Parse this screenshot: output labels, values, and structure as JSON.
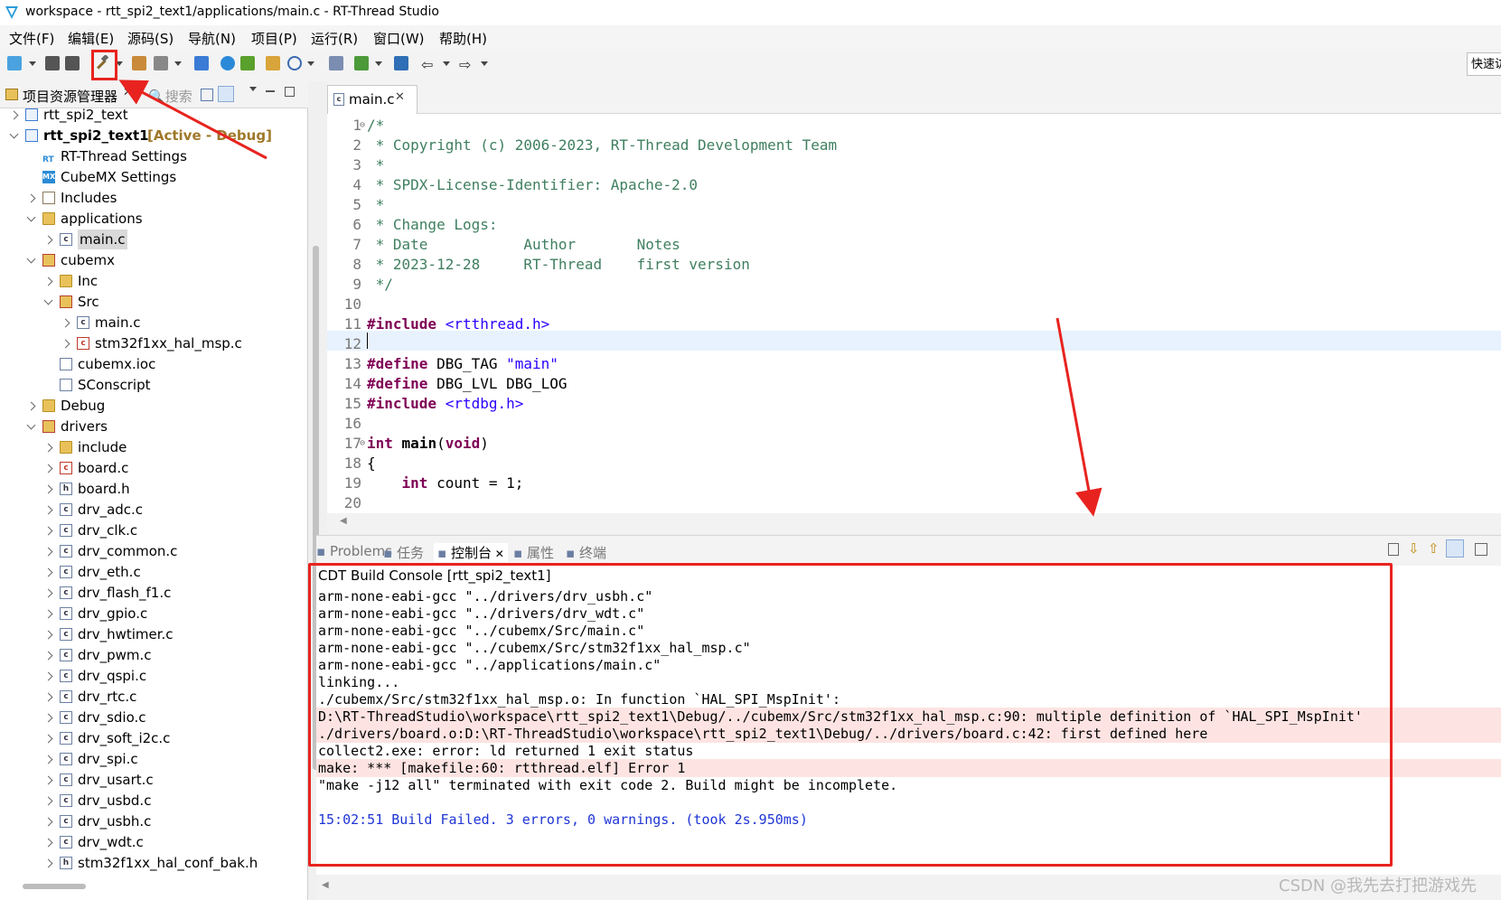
{
  "window": {
    "title": "workspace - rtt_spi2_text1/applications/main.c - RT-Thread Studio",
    "quick_access": "快速访"
  },
  "menu": [
    "文件(F)",
    "编辑(E)",
    "源码(S)",
    "导航(N)",
    "项目(P)",
    "运行(R)",
    "窗口(W)",
    "帮助(H)"
  ],
  "left_panel": {
    "tab_label": "项目资源管理器",
    "search_tab": "搜索",
    "tree": [
      {
        "label": "rtt_spi2_text",
        "tag": "",
        "icon": "project-icon",
        "state": "collapsed",
        "depth": 0
      },
      {
        "label": "rtt_spi2_text1",
        "tag": "[Active - Debug]",
        "icon": "project-icon",
        "state": "expanded",
        "depth": 0,
        "bold": true
      },
      {
        "label": "RT-Thread Settings",
        "tag": "",
        "icon": "rt-settings-icon",
        "state": "none",
        "depth": 1
      },
      {
        "label": "CubeMX Settings",
        "tag": "",
        "icon": "cubemx-icon",
        "state": "none",
        "depth": 1
      },
      {
        "label": "Includes",
        "tag": "",
        "icon": "includes-icon",
        "state": "collapsed",
        "depth": 1
      },
      {
        "label": "applications",
        "tag": "",
        "icon": "folder-icon",
        "state": "expanded",
        "depth": 1
      },
      {
        "label": "main.c",
        "tag": "",
        "icon": "c-file-icon",
        "state": "collapsed",
        "depth": 2,
        "selected": true
      },
      {
        "label": "cubemx",
        "tag": "",
        "icon": "source-folder-icon",
        "state": "expanded",
        "depth": 1
      },
      {
        "label": "Inc",
        "tag": "",
        "icon": "folder-icon",
        "state": "collapsed",
        "depth": 2
      },
      {
        "label": "Src",
        "tag": "",
        "icon": "source-folder-icon",
        "state": "expanded",
        "depth": 2
      },
      {
        "label": "main.c",
        "tag": "",
        "icon": "c-file-icon",
        "state": "collapsed",
        "depth": 3
      },
      {
        "label": "stm32f1xx_hal_msp.c",
        "tag": "",
        "icon": "c-file-error-icon",
        "state": "collapsed",
        "depth": 3
      },
      {
        "label": "cubemx.ioc",
        "tag": "",
        "icon": "file-icon",
        "state": "none",
        "depth": 2
      },
      {
        "label": "SConscript",
        "tag": "",
        "icon": "file-icon",
        "state": "none",
        "depth": 2
      },
      {
        "label": "Debug",
        "tag": "",
        "icon": "folder-icon",
        "state": "collapsed",
        "depth": 1
      },
      {
        "label": "drivers",
        "tag": "",
        "icon": "source-folder-icon",
        "state": "expanded",
        "depth": 1
      },
      {
        "label": "include",
        "tag": "",
        "icon": "folder-icon",
        "state": "collapsed",
        "depth": 2
      },
      {
        "label": "board.c",
        "tag": "",
        "icon": "c-file-error-icon",
        "state": "collapsed",
        "depth": 2
      },
      {
        "label": "board.h",
        "tag": "",
        "icon": "h-file-icon",
        "state": "collapsed",
        "depth": 2
      },
      {
        "label": "drv_adc.c",
        "tag": "",
        "icon": "c-file-icon",
        "state": "collapsed",
        "depth": 2
      },
      {
        "label": "drv_clk.c",
        "tag": "",
        "icon": "c-file-icon",
        "state": "collapsed",
        "depth": 2
      },
      {
        "label": "drv_common.c",
        "tag": "",
        "icon": "c-file-icon",
        "state": "collapsed",
        "depth": 2
      },
      {
        "label": "drv_eth.c",
        "tag": "",
        "icon": "c-file-icon",
        "state": "collapsed",
        "depth": 2
      },
      {
        "label": "drv_flash_f1.c",
        "tag": "",
        "icon": "c-file-icon",
        "state": "collapsed",
        "depth": 2
      },
      {
        "label": "drv_gpio.c",
        "tag": "",
        "icon": "c-file-icon",
        "state": "collapsed",
        "depth": 2
      },
      {
        "label": "drv_hwtimer.c",
        "tag": "",
        "icon": "c-file-icon",
        "state": "collapsed",
        "depth": 2
      },
      {
        "label": "drv_pwm.c",
        "tag": "",
        "icon": "c-file-icon",
        "state": "collapsed",
        "depth": 2
      },
      {
        "label": "drv_qspi.c",
        "tag": "",
        "icon": "c-file-icon",
        "state": "collapsed",
        "depth": 2
      },
      {
        "label": "drv_rtc.c",
        "tag": "",
        "icon": "c-file-icon",
        "state": "collapsed",
        "depth": 2
      },
      {
        "label": "drv_sdio.c",
        "tag": "",
        "icon": "c-file-icon",
        "state": "collapsed",
        "depth": 2
      },
      {
        "label": "drv_soft_i2c.c",
        "tag": "",
        "icon": "c-file-icon",
        "state": "collapsed",
        "depth": 2
      },
      {
        "label": "drv_spi.c",
        "tag": "",
        "icon": "c-file-icon",
        "state": "collapsed",
        "depth": 2
      },
      {
        "label": "drv_usart.c",
        "tag": "",
        "icon": "c-file-icon",
        "state": "collapsed",
        "depth": 2
      },
      {
        "label": "drv_usbd.c",
        "tag": "",
        "icon": "c-file-icon",
        "state": "collapsed",
        "depth": 2
      },
      {
        "label": "drv_usbh.c",
        "tag": "",
        "icon": "c-file-icon",
        "state": "collapsed",
        "depth": 2
      },
      {
        "label": "drv_wdt.c",
        "tag": "",
        "icon": "c-file-icon",
        "state": "collapsed",
        "depth": 2
      },
      {
        "label": "stm32f1xx_hal_conf_bak.h",
        "tag": "",
        "icon": "h-file-icon",
        "state": "collapsed",
        "depth": 2
      }
    ]
  },
  "editor": {
    "tab_label": "main.c",
    "lines": [
      {
        "n": "1",
        "fold": true,
        "parts": [
          [
            "cm",
            "/*"
          ]
        ]
      },
      {
        "n": "2",
        "parts": [
          [
            "cm",
            " * Copyright (c) 2006-2023, RT-Thread Development Team"
          ]
        ]
      },
      {
        "n": "3",
        "parts": [
          [
            "cm",
            " *"
          ]
        ]
      },
      {
        "n": "4",
        "parts": [
          [
            "cm",
            " * SPDX-License-Identifier: Apache-2.0"
          ]
        ]
      },
      {
        "n": "5",
        "parts": [
          [
            "cm",
            " *"
          ]
        ]
      },
      {
        "n": "6",
        "parts": [
          [
            "cm",
            " * Change Logs:"
          ]
        ]
      },
      {
        "n": "7",
        "parts": [
          [
            "cm",
            " * Date           Author       Notes"
          ]
        ]
      },
      {
        "n": "8",
        "parts": [
          [
            "cm",
            " * 2023-12-28     RT-Thread    first version"
          ]
        ]
      },
      {
        "n": "9",
        "parts": [
          [
            "cm",
            " */"
          ]
        ]
      },
      {
        "n": "10",
        "parts": []
      },
      {
        "n": "11",
        "parts": [
          [
            "kw",
            "#include"
          ],
          [
            "pl",
            " "
          ],
          [
            "st",
            "<rtthread.h>"
          ]
        ]
      },
      {
        "n": "12",
        "parts": []
      },
      {
        "n": "13",
        "parts": [
          [
            "kw",
            "#define"
          ],
          [
            "pl",
            " DBG_TAG "
          ],
          [
            "st",
            "\"main\""
          ]
        ]
      },
      {
        "n": "14",
        "parts": [
          [
            "kw",
            "#define"
          ],
          [
            "pl",
            " DBG_LVL DBG_LOG"
          ]
        ]
      },
      {
        "n": "15",
        "parts": [
          [
            "kw",
            "#include"
          ],
          [
            "pl",
            " "
          ],
          [
            "st",
            "<rtdbg.h>"
          ]
        ]
      },
      {
        "n": "16",
        "parts": []
      },
      {
        "n": "17",
        "fold": true,
        "parts": [
          [
            "kw",
            "int"
          ],
          [
            "pl",
            " "
          ],
          [
            "b",
            "main"
          ],
          [
            "pl",
            "("
          ],
          [
            "kw",
            "void"
          ],
          [
            "pl",
            ")"
          ]
        ]
      },
      {
        "n": "18",
        "parts": [
          [
            "pl",
            "{"
          ]
        ]
      },
      {
        "n": "19",
        "parts": [
          [
            "pl",
            "    "
          ],
          [
            "kw",
            "int"
          ],
          [
            "pl",
            " count = 1;"
          ]
        ]
      },
      {
        "n": "20",
        "parts": []
      }
    ]
  },
  "console": {
    "tabs": [
      {
        "label": "Problems",
        "icon": "problems-icon",
        "active": false
      },
      {
        "label": "任务",
        "icon": "tasks-icon",
        "active": false
      },
      {
        "label": "控制台",
        "icon": "console-icon",
        "active": true
      },
      {
        "label": "属性",
        "icon": "properties-icon",
        "active": false
      },
      {
        "label": "终端",
        "icon": "terminal-icon",
        "active": false
      }
    ],
    "title": "CDT Build Console [rtt_spi2_text1]",
    "lines": [
      {
        "text": "arm-none-eabi-gcc \"../drivers/drv_usbh.c\"",
        "kind": "normal"
      },
      {
        "text": "arm-none-eabi-gcc \"../drivers/drv_wdt.c\"",
        "kind": "normal"
      },
      {
        "text": "arm-none-eabi-gcc \"../cubemx/Src/main.c\"",
        "kind": "normal"
      },
      {
        "text": "arm-none-eabi-gcc \"../cubemx/Src/stm32f1xx_hal_msp.c\"",
        "kind": "normal"
      },
      {
        "text": "arm-none-eabi-gcc \"../applications/main.c\"",
        "kind": "normal"
      },
      {
        "text": "linking...",
        "kind": "normal"
      },
      {
        "text": "./cubemx/Src/stm32f1xx_hal_msp.o: In function `HAL_SPI_MspInit':",
        "kind": "normal"
      },
      {
        "text": "D:\\RT-ThreadStudio\\workspace\\rtt_spi2_text1\\Debug/../cubemx/Src/stm32f1xx_hal_msp.c:90: multiple definition of `HAL_SPI_MspInit'",
        "kind": "error"
      },
      {
        "text": "./drivers/board.o:D:\\RT-ThreadStudio\\workspace\\rtt_spi2_text1\\Debug/../drivers/board.c:42: first defined here",
        "kind": "error"
      },
      {
        "text": "collect2.exe: error: ld returned 1 exit status",
        "kind": "normal"
      },
      {
        "text": "make: *** [makefile:60: rtthread.elf] Error 1",
        "kind": "error"
      },
      {
        "text": "\"make -j12 all\" terminated with exit code 2. Build might be incomplete.",
        "kind": "normal"
      },
      {
        "text": "",
        "kind": "normal"
      },
      {
        "text": "15:02:51 Build Failed. 3 errors, 0 warnings. (took 2s.950ms)",
        "kind": "status"
      }
    ]
  },
  "watermark": "CSDN @我先去打把游戏先",
  "colors": {
    "annotation_red": "#e8231f",
    "error_bg": "#fde4e2",
    "status_blue": "#1f35d6",
    "active_tag": "#a0782a"
  }
}
